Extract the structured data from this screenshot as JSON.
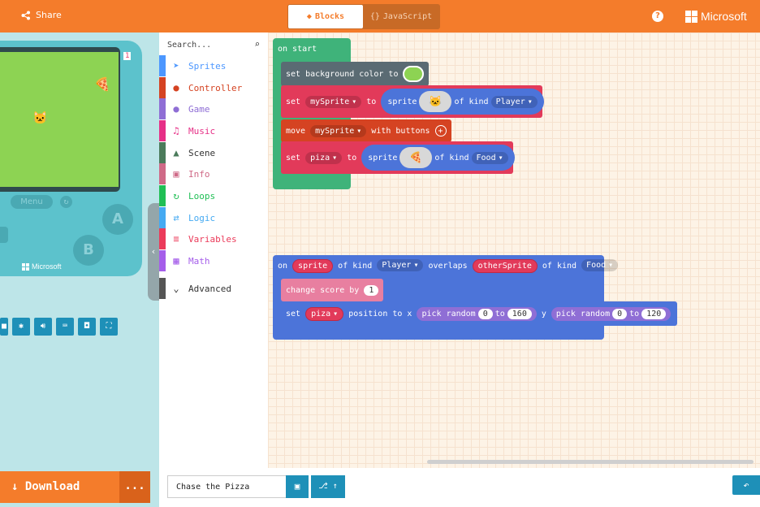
{
  "header": {
    "share_label": "Share",
    "tabs": [
      {
        "label": "Blocks",
        "icon": "puzzle-icon",
        "active": true
      },
      {
        "label": "JavaScript",
        "icon": "braces-icon",
        "active": false
      }
    ],
    "help_label": "?",
    "brand": "Microsoft"
  },
  "simulator": {
    "score": "1",
    "menu_label": "Menu",
    "a_label": "A",
    "b_label": "B",
    "device_brand": "Microsoft",
    "download_label": "Download",
    "more_label": "...",
    "screen_color": "#8dd353"
  },
  "toolbox": {
    "search_placeholder": "Search...",
    "categories": [
      {
        "label": "Sprites",
        "color": "#4c97ff",
        "icon": "paper-plane-icon"
      },
      {
        "label": "Controller",
        "color": "#d54322",
        "icon": "gamepad-icon"
      },
      {
        "label": "Game",
        "color": "#8f6ed5",
        "icon": "circle-icon"
      },
      {
        "label": "Music",
        "color": "#e63087",
        "icon": "headphones-icon"
      },
      {
        "label": "Scene",
        "color": "#4b7b5b",
        "icon": "tree-icon"
      },
      {
        "label": "Info",
        "color": "#cf6a87",
        "icon": "id-card-icon"
      },
      {
        "label": "Loops",
        "color": "#20bf55",
        "icon": "refresh-icon"
      },
      {
        "label": "Logic",
        "color": "#45aaf2",
        "icon": "shuffle-icon"
      },
      {
        "label": "Variables",
        "color": "#eb3b5a",
        "icon": "list-icon"
      },
      {
        "label": "Math",
        "color": "#a55eea",
        "icon": "calculator-icon"
      },
      {
        "label": "Advanced",
        "color": "#555555",
        "icon": "chevron-down-icon"
      }
    ]
  },
  "blocks": {
    "on_start": "on start",
    "set_bg": "set background color to",
    "set": "set",
    "to": "to",
    "sprite": "sprite",
    "of_kind": "of kind",
    "my_sprite": "mySprite",
    "kind_player": "Player",
    "move": "move",
    "with_buttons": "with buttons",
    "piza": "piza",
    "kind_food": "Food",
    "on": "on",
    "overlaps": "overlaps",
    "other_sprite": "otherSprite",
    "change_score": "change score by",
    "score_value": "1",
    "position_to_x": "position to x",
    "pick_random": "pick random",
    "x_min": "0",
    "x_max": "160",
    "y": "y",
    "y_min": "0",
    "y_max": "120",
    "bg_color": "#8dd353"
  },
  "footer": {
    "project_name": "Chase the Pizza"
  }
}
